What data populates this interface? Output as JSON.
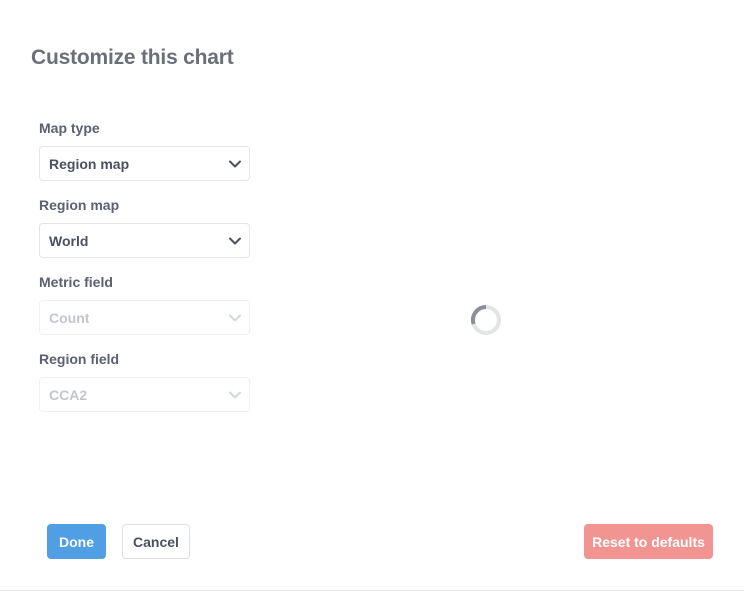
{
  "modal": {
    "title": "Customize this chart"
  },
  "settings": {
    "fields": [
      {
        "label": "Map type",
        "value": "Region map",
        "disabled": false
      },
      {
        "label": "Region map",
        "value": "World",
        "disabled": false
      },
      {
        "label": "Metric field",
        "value": "Count",
        "disabled": true
      },
      {
        "label": "Region field",
        "value": "CCA2",
        "disabled": true
      }
    ]
  },
  "preview": {
    "loading_icon": "spinner-icon"
  },
  "footer": {
    "done_label": "Done",
    "cancel_label": "Cancel",
    "reset_label": "Reset to defaults"
  },
  "colors": {
    "primary": "#509ee3",
    "danger": "#f19492",
    "text": "#4c5060",
    "disabled_text": "#c3c6cc"
  }
}
